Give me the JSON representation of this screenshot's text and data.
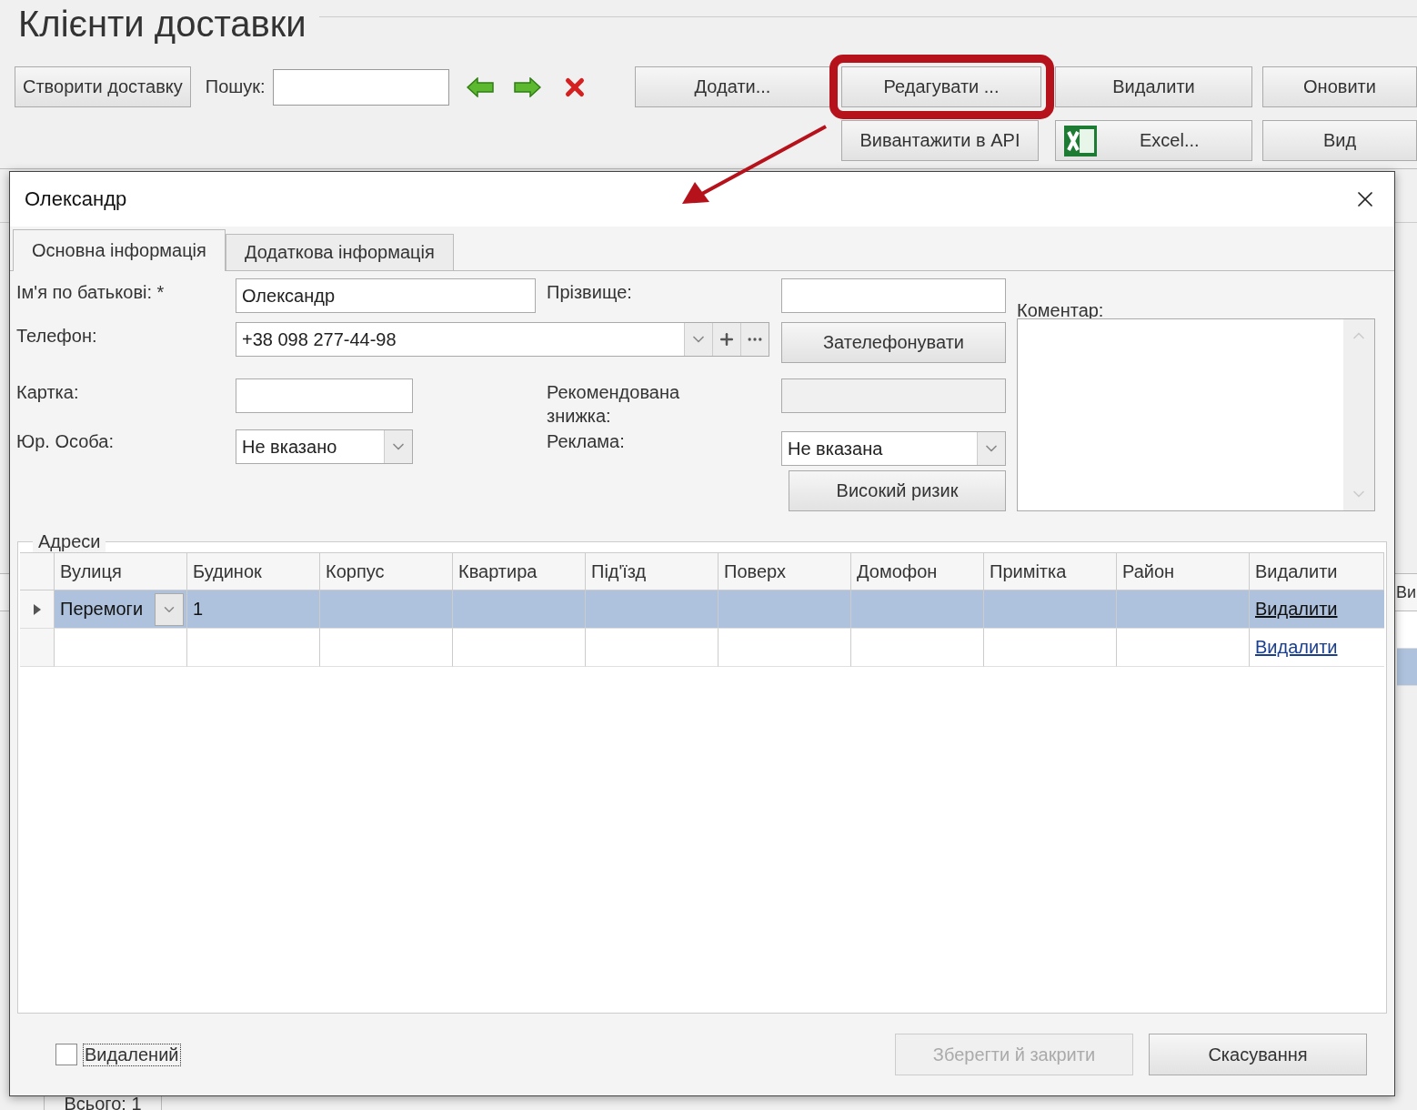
{
  "background_window": {
    "title": "Клієнти доставки",
    "toolbar": {
      "create_button": "Створити доставку",
      "search_label": "Пошук:",
      "buttons": [
        {
          "label": "Додати...",
          "highlighted": false
        },
        {
          "label": "Редагувати ...",
          "highlighted": true
        },
        {
          "label": "Видалити",
          "highlighted": false
        },
        {
          "label": "Оновити",
          "highlighted": false
        }
      ],
      "second_row": [
        {
          "label": "Вивантажити в API",
          "kind": "plain"
        },
        {
          "label": "Excel...",
          "kind": "excel"
        },
        {
          "label": "Вид",
          "kind": "plain"
        }
      ]
    },
    "grid": {
      "column_header": "Ви",
      "rows": [
        {
          "selected": false
        },
        {
          "selected": true
        }
      ]
    },
    "status": "Всього: 1"
  },
  "dialog": {
    "title": "Олександр",
    "tabs": [
      {
        "label": "Основна інформація",
        "selected": true
      },
      {
        "label": "Додаткова інформація",
        "selected": false
      }
    ],
    "form": {
      "name": {
        "label": "Ім'я по батькові: *",
        "value": "Олександр"
      },
      "surname": {
        "label": "Прізвище:"
      },
      "phone": {
        "label": "Телефон:",
        "value": "+38 098 277-44-98"
      },
      "call_button": "Зателефонувати",
      "card": {
        "label": "Картка:"
      },
      "discount": {
        "label": "Рекомендована знижка:",
        "disabled": true
      },
      "legal_entity": {
        "label": "Юр. Особа:",
        "value": "Не вказано"
      },
      "advertising": {
        "label": "Реклама:",
        "value": "Не вказана"
      },
      "risk_button": "Високий ризик",
      "comment": {
        "label": "Коментар:"
      }
    },
    "addresses": {
      "legend": "Адреси",
      "columns": [
        "Вулиця",
        "Будинок",
        "Корпус",
        "Квартира",
        "Під'їзд",
        "Поверх",
        "Домофон",
        "Примітка",
        "Район",
        "Видалити"
      ],
      "rows": [
        {
          "selected": true,
          "street": "Перемоги",
          "house": "1",
          "delete_link": "Видалити"
        },
        {
          "selected": false,
          "delete_link": "Видалити"
        }
      ]
    },
    "deleted_checkbox": {
      "label": "Видалений",
      "checked": false
    },
    "buttons": [
      {
        "label": "Зберегти й закрити",
        "disabled": true
      },
      {
        "label": "Скасування",
        "disabled": false
      }
    ]
  }
}
